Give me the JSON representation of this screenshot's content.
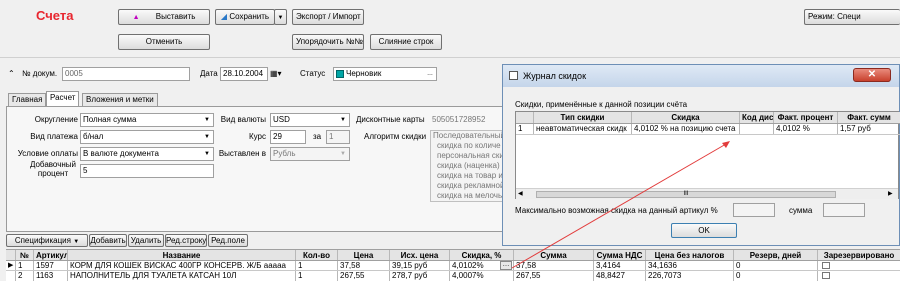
{
  "app": {
    "title": "Счета",
    "title_color": "#e8262f"
  },
  "toolbar": {
    "insert_label": "Выставить",
    "save_label": "Сохранить",
    "export_label": "Экспорт / Импорт",
    "cancel_label": "Отменить",
    "order_label": "Упорядочить №№",
    "merge_label": "Слияние строк",
    "mode_label": "Режим: Специ"
  },
  "form": {
    "doc_label": "№ докум.",
    "doc_value": "0005",
    "date_label": "Дата",
    "date_value": "28.10.2004",
    "status_label": "Статус",
    "status_value": "Черновик"
  },
  "tabs": [
    "Главная",
    "Расчет",
    "Вложения и метки"
  ],
  "calc": {
    "rounding_label": "Округление",
    "rounding_value": "Полная сумма",
    "payment_label": "Вид платежа",
    "payment_value": "б/нал",
    "pay_cond_label": "Условие оплаты",
    "pay_cond_value": "В валюте документа",
    "extra_pct_label": "Добавочный процент",
    "extra_pct_value": "5",
    "currency_label": "Вид валюты",
    "currency_value": "USD",
    "rate_label": "Курс",
    "rate_value": "29",
    "for_label": "за",
    "for_value": "1",
    "issued_in_label": "Выставлен в",
    "issued_in_value": "Рубль",
    "cards_label": "Дисконтные карты",
    "cards_value": "505051728952",
    "algo_label": "Алгоритм скидки",
    "algo_lines": [
      "Последовательный",
      "скидка по количе",
      "персональная ски",
      "скидка (наценка)",
      "скидка на товар и",
      "скидка рекламной",
      "скидка на мелочь"
    ]
  },
  "spec_toolbar": {
    "spec": "Спецификация",
    "add": "Добавить",
    "delete": "Удалить",
    "edit_row": "Ред.строку",
    "edit_field": "Ред.поле"
  },
  "grid": {
    "columns": [
      "№",
      "Артикул",
      "Название",
      "Кол-во",
      "Цена",
      "Исх. цена",
      "Скидка, %",
      "Сумма",
      "Сумма НДС",
      "Цена без налогов",
      "Резерв, дней",
      "Зарезервировано"
    ],
    "rows": [
      {
        "num": "1",
        "article": "1597",
        "name": "КОРМ ДЛЯ КОШЕК ВИСКАС 400ГР КОНСЕРВ. Ж/Б ааааа",
        "qty": "1",
        "price": "37,58",
        "orig_price": "39,15 руб",
        "discount": "4,0102%",
        "sum": "37,58",
        "vat": "3,4164",
        "net": "34,1636",
        "reserve": "0"
      },
      {
        "num": "2",
        "article": "1163",
        "name": "НАПОЛНИТЕЛЬ ДЛЯ ТУАЛЕТА КАТСАН 10Л",
        "qty": "1",
        "price": "267,55",
        "orig_price": "278,7 руб",
        "discount": "4,0007%",
        "sum": "267,55",
        "vat": "48,8427",
        "net": "226,7073",
        "reserve": "0"
      }
    ]
  },
  "popup": {
    "title": "Журнал скидок",
    "subtitle": "Скидки, применённые к данной позиции счёта",
    "columns": [
      "",
      "Тип скидки",
      "Скидка",
      "Код дис",
      "Факт. процент",
      "Факт. сумм"
    ],
    "rows": [
      {
        "num": "1",
        "type": "неавтоматическая скидк",
        "discount": "4,0102 % на позицию счета",
        "code": "",
        "pct": "4,0102 %",
        "sum": "1,57 руб"
      }
    ],
    "scroll_marker": "III",
    "max_label": "Максимально возможная скидка на данный артикул %",
    "sum_label": "сумма",
    "ok_label": "OK"
  },
  "colors": {
    "status_icon": "#00a6a6",
    "arrow": "#e23b3b"
  }
}
